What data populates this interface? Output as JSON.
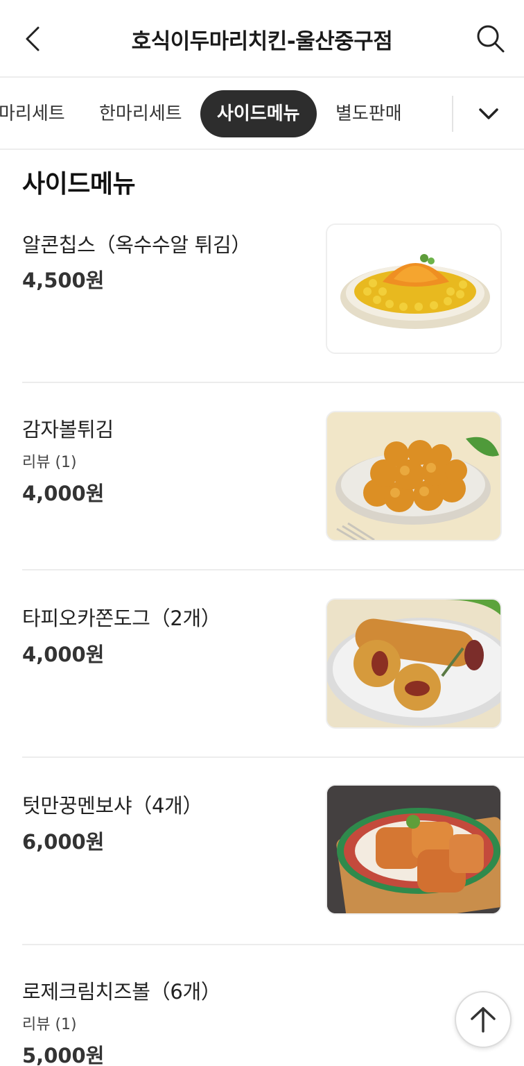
{
  "header": {
    "title": "호식이두마리치킨-울산중구점",
    "back_icon": "chevron-left-icon",
    "search_icon": "search-icon"
  },
  "tabs": {
    "items": [
      {
        "label": "두마리세트",
        "visible_label": "마리세트"
      },
      {
        "label": "한마리세트"
      },
      {
        "label": "사이드메뉴",
        "active": true
      },
      {
        "label": "별도판매"
      }
    ],
    "more_icon": "chevron-down-icon"
  },
  "section": {
    "title": "사이드메뉴"
  },
  "menu_items": [
    {
      "name": "알콘칩스（옥수수알 튀김）",
      "review": "",
      "price": "4,500원",
      "image": "corn-chips-food-image"
    },
    {
      "name": "감자볼튀김",
      "review": "리뷰 (1)",
      "price": "4,000원",
      "image": "potato-balls-food-image"
    },
    {
      "name": "타피오카쫀도그（2개）",
      "review": "",
      "price": "4,000원",
      "image": "tapioca-corndog-food-image"
    },
    {
      "name": "텃만꿍멘보샤（4개）",
      "review": "",
      "price": "6,000원",
      "image": "menbosha-food-image"
    },
    {
      "name": "로제크림치즈볼（6개）",
      "review": "리뷰 (1)",
      "price": "5,000원",
      "image": ""
    }
  ],
  "scroll_top": {
    "icon": "arrow-up-icon"
  },
  "colors": {
    "active_tab_bg": "#2d2d2d",
    "divider": "#ececec",
    "text": "#222222"
  }
}
